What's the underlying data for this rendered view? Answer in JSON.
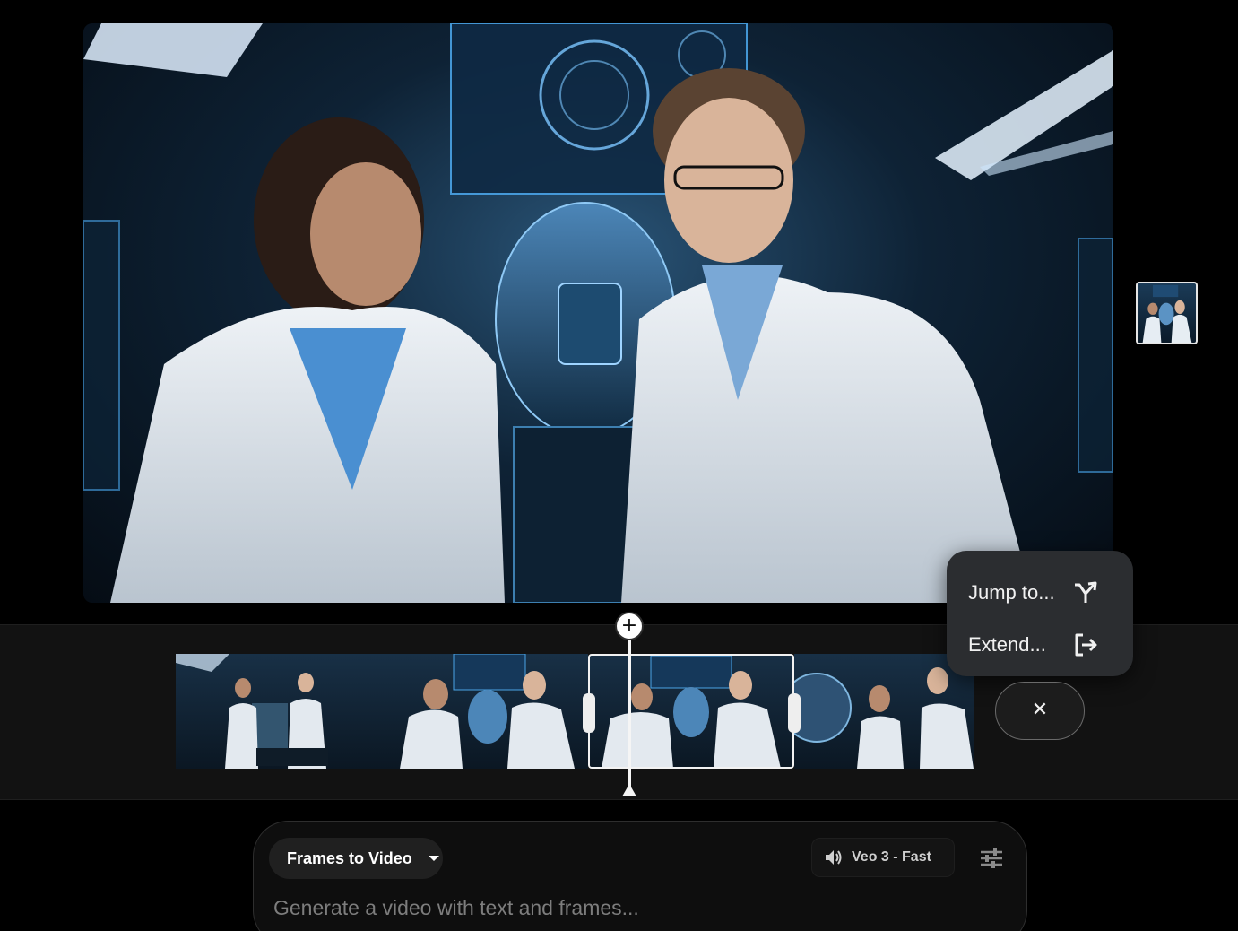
{
  "menu": {
    "jump_label": "Jump to...",
    "jump_icon": "merge-arrow-icon",
    "extend_label": "Extend...",
    "extend_icon": "logout-arrow-icon"
  },
  "close_button": {
    "label": "✕",
    "icon": "close-icon"
  },
  "timeline": {
    "add_label": "+",
    "clips": [
      {
        "name": "clip-1"
      },
      {
        "name": "clip-2"
      },
      {
        "name": "clip-3",
        "selected": true
      },
      {
        "name": "clip-4"
      }
    ]
  },
  "composer": {
    "mode_label": "Frames to Video",
    "model_label": "Veo 3 - Fast",
    "model_icon": "speaker-icon",
    "settings_icon": "sliders-icon",
    "prompt_placeholder": "Generate a video with text and frames..."
  },
  "colors": {
    "background": "#000000",
    "timeline_bg": "#121212",
    "menu_bg": "#2b2d30",
    "accent_blue": "#5fb4ff"
  }
}
